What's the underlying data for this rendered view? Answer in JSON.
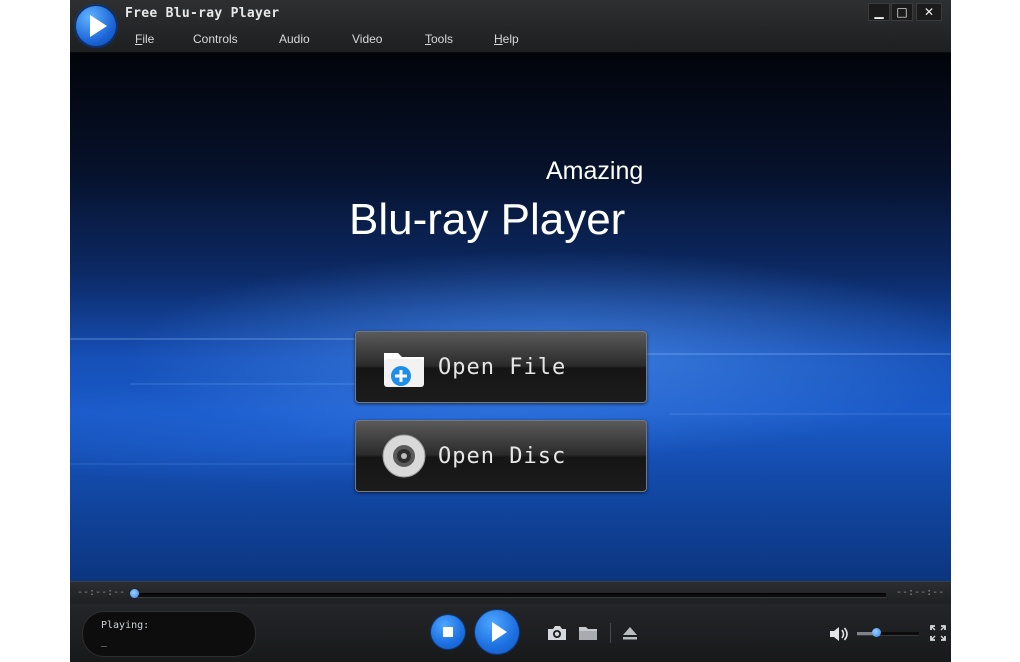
{
  "window": {
    "title": "Free Blu-ray Player",
    "minimize_glyph": "▁",
    "maximize_glyph": "□",
    "close_glyph": "✕"
  },
  "menu": {
    "items": [
      {
        "label_rest": "ile",
        "underline": "F"
      },
      {
        "label_rest": "Controls",
        "underline": ""
      },
      {
        "label_rest": "Audio",
        "underline": ""
      },
      {
        "label_rest": "Video",
        "underline": ""
      },
      {
        "label_rest": "ools",
        "underline": "T"
      },
      {
        "label_rest": "elp",
        "underline": "H"
      }
    ]
  },
  "hero": {
    "line1": "Amazing",
    "line2": "Blu-ray Player"
  },
  "actions": {
    "open_file": "Open File",
    "open_disc": "Open Disc"
  },
  "playback": {
    "elapsed": "--:--:--",
    "total": "--:--:--",
    "progress": 0.0,
    "volume": 0.3,
    "status_label": "Playing:",
    "status_value": "_"
  },
  "icons": {
    "logo": "play-logo-icon",
    "open_file": "folder-plus-icon",
    "open_disc": "disc-icon",
    "stop": "stop-icon",
    "play": "play-icon",
    "snapshot": "camera-icon",
    "snapshot_folder": "folder-icon",
    "eject": "eject-icon",
    "volume": "speaker-icon",
    "fullscreen": "fullscreen-icon"
  },
  "colors": {
    "accent": "#1c6fe0",
    "titlebar": "#2d2f31",
    "controls_bg": "#1d1e20"
  }
}
